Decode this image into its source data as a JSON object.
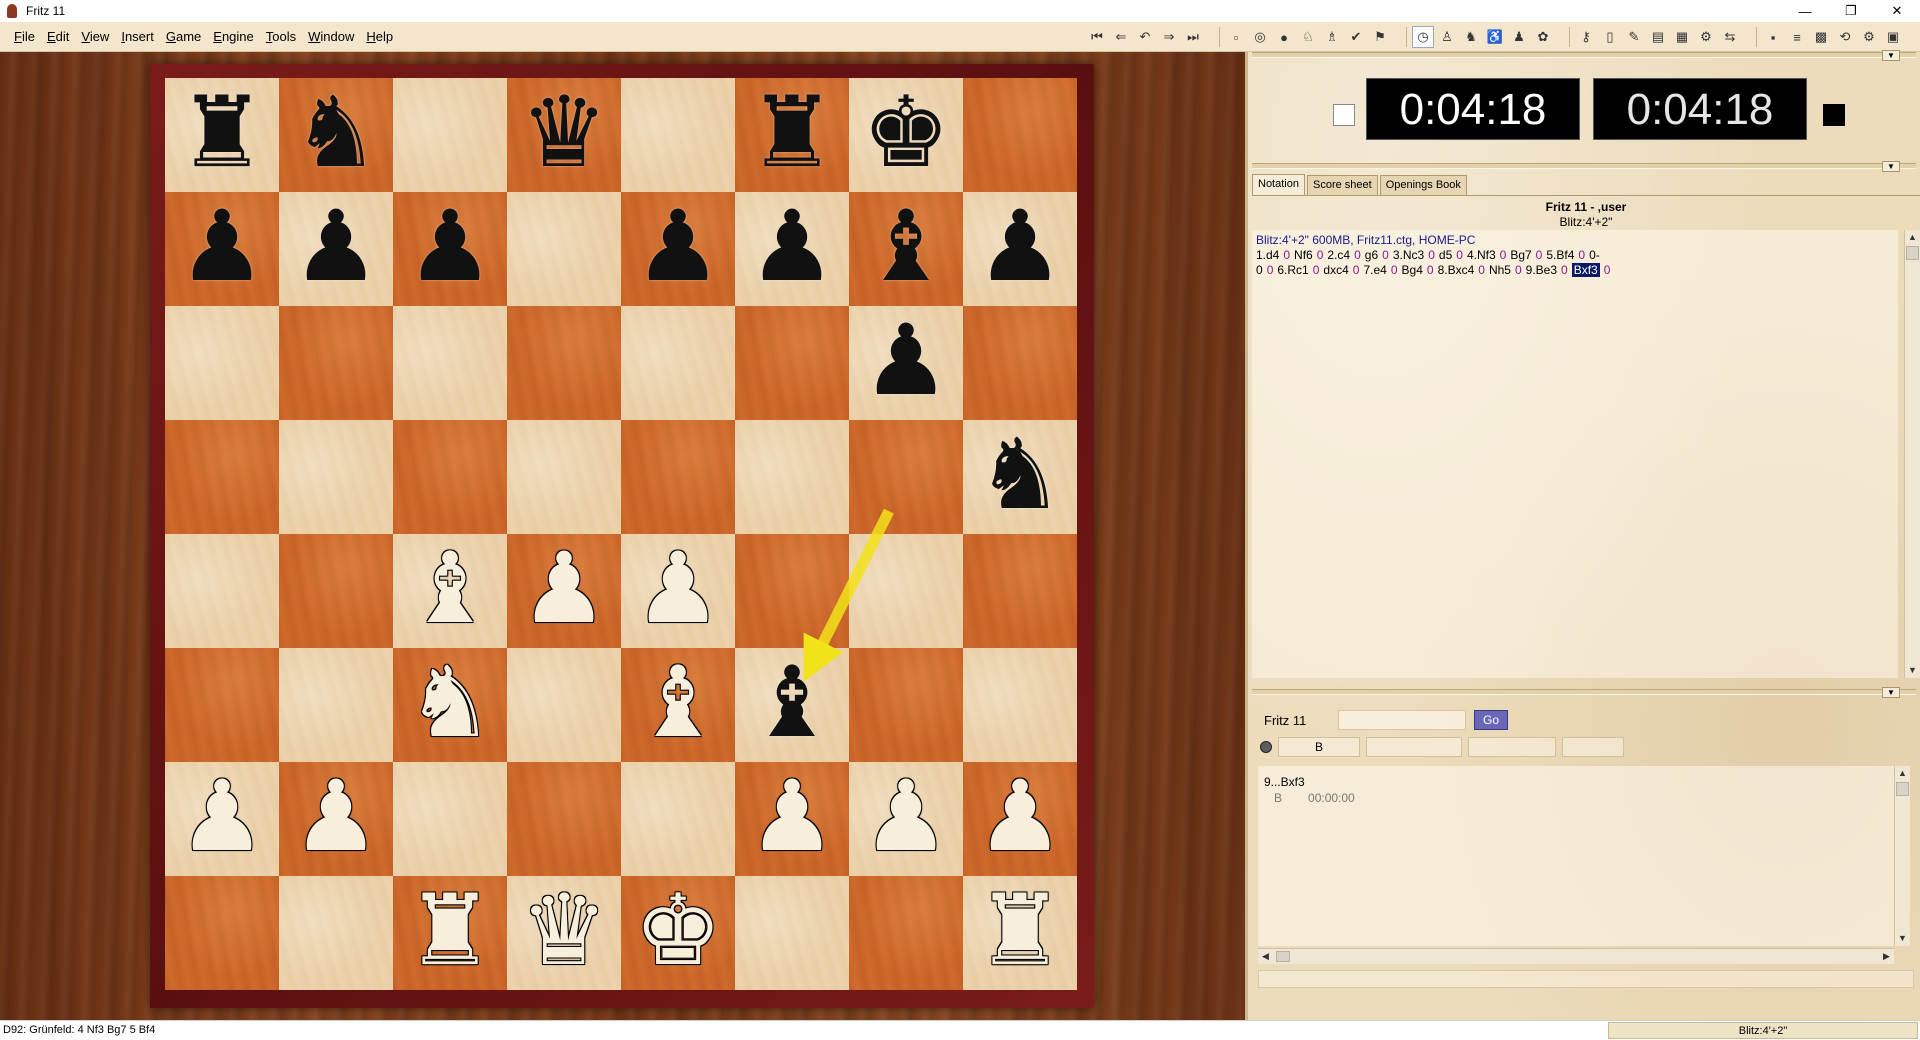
{
  "window": {
    "title": "Fritz 11",
    "controls": {
      "minimize": "—",
      "restore": "❐",
      "close": "✕"
    }
  },
  "menu": [
    {
      "label": "File",
      "mnemonic": "F",
      "rest": "ile"
    },
    {
      "label": "Edit",
      "mnemonic": "E",
      "rest": "dit"
    },
    {
      "label": "View",
      "mnemonic": "V",
      "rest": "iew"
    },
    {
      "label": "Insert",
      "mnemonic": "I",
      "rest": "nsert"
    },
    {
      "label": "Game",
      "mnemonic": "G",
      "rest": "ame"
    },
    {
      "label": "Engine",
      "mnemonic": "E",
      "rest": "ngine"
    },
    {
      "label": "Tools",
      "mnemonic": "T",
      "rest": "ools"
    },
    {
      "label": "Window",
      "mnemonic": "W",
      "rest": "indow"
    },
    {
      "label": "Help",
      "mnemonic": "H",
      "rest": "elp"
    }
  ],
  "toolbar": {
    "nav": [
      {
        "icon": "first-move-icon",
        "glyph": "⏮"
      },
      {
        "icon": "back-move-icon",
        "glyph": "⇐"
      },
      {
        "icon": "take-back-icon",
        "glyph": "↶"
      },
      {
        "icon": "forward-move-icon",
        "glyph": "⇒"
      },
      {
        "icon": "last-move-icon",
        "glyph": "⏭"
      }
    ],
    "game": [
      {
        "icon": "new-game-icon",
        "glyph": "▫"
      },
      {
        "icon": "book-icon",
        "glyph": "◎"
      },
      {
        "icon": "hint-icon",
        "glyph": "●"
      },
      {
        "icon": "analysis-icon",
        "glyph": "♘"
      },
      {
        "icon": "engine-icon",
        "glyph": "♗"
      },
      {
        "icon": "check-icon",
        "glyph": "✔"
      },
      {
        "icon": "flag-icon",
        "glyph": "⚑"
      }
    ],
    "mode": [
      {
        "icon": "clock-icon",
        "glyph": "◷",
        "active": true
      },
      {
        "icon": "pawn-mode-icon",
        "glyph": "♙"
      },
      {
        "icon": "knight-mode-icon",
        "glyph": "♞"
      },
      {
        "icon": "handicap-icon",
        "glyph": "♿"
      },
      {
        "icon": "friend-mode-icon",
        "glyph": "♟"
      },
      {
        "icon": "sparring-icon",
        "glyph": "✿"
      }
    ],
    "tools": [
      {
        "icon": "key-icon",
        "glyph": "⚷"
      },
      {
        "icon": "book-open-icon",
        "glyph": "▯"
      },
      {
        "icon": "pen-icon",
        "glyph": "✎"
      },
      {
        "icon": "database-icon",
        "glyph": "▤"
      },
      {
        "icon": "board-icon",
        "glyph": "▦"
      },
      {
        "icon": "server-icon",
        "glyph": "⚙"
      },
      {
        "icon": "links-icon",
        "glyph": "⇆"
      }
    ],
    "file": [
      {
        "icon": "save-icon",
        "glyph": "▪"
      },
      {
        "icon": "layout-icon",
        "glyph": "≡"
      },
      {
        "icon": "board-3d-icon",
        "glyph": "▩"
      },
      {
        "icon": "flip-board-icon",
        "glyph": "⟲"
      },
      {
        "icon": "settings-icon",
        "glyph": "⚙"
      },
      {
        "icon": "fullscreen-icon",
        "glyph": "▣"
      }
    ]
  },
  "board": {
    "rows": [
      [
        "br",
        "bn",
        "",
        "bq",
        "",
        "br",
        "bk",
        ""
      ],
      [
        "bp",
        "bp",
        "bp",
        "",
        "bp",
        "bp",
        "bb",
        "bp"
      ],
      [
        "",
        "",
        "",
        "",
        "",
        "",
        "bp",
        ""
      ],
      [
        "",
        "",
        "",
        "",
        "",
        "",
        "",
        "bn"
      ],
      [
        "",
        "",
        "wb",
        "wp",
        "wp",
        "",
        "",
        ""
      ],
      [
        "",
        "",
        "wn",
        "",
        "wb",
        "bb",
        "",
        ""
      ],
      [
        "wp",
        "wp",
        "",
        "",
        "",
        "wp",
        "wp",
        "wp"
      ],
      [
        "",
        "",
        "wr",
        "wq",
        "wk",
        "",
        "",
        "wr"
      ]
    ],
    "glyphs": {
      "k": "♚",
      "q": "♛",
      "r": "♜",
      "b": "♝",
      "n": "♞",
      "p": "♟"
    },
    "last_move_arrow": {
      "from": "g5",
      "to": "f3",
      "color": "#f2e21a"
    }
  },
  "clocks": {
    "white_time": "0:04:18",
    "black_time": "0:04:18"
  },
  "notation": {
    "tabs": [
      "Notation",
      "Score sheet",
      "Openings Book"
    ],
    "active_tab": "Notation",
    "players": "Fritz 11 - ,user",
    "event": "Blitz:4'+2\"",
    "game_info": "Blitz:4'+2\"  600MB, Fritz11.ctg, HOME-PC",
    "moves": [
      {
        "san": "1.d4",
        "ann": "0"
      },
      {
        "san": "Nf6",
        "ann": "0"
      },
      {
        "san": "2.c4",
        "ann": "0"
      },
      {
        "san": "g6",
        "ann": "0"
      },
      {
        "san": "3.Nc3",
        "ann": "0"
      },
      {
        "san": "d5",
        "ann": "0"
      },
      {
        "san": "4.Nf3",
        "ann": "0"
      },
      {
        "san": "Bg7",
        "ann": "0"
      },
      {
        "san": "5.Bf4",
        "ann": "0"
      },
      {
        "san": "0-0",
        "ann": "0"
      },
      {
        "san": "6.Rc1",
        "ann": "0"
      },
      {
        "san": "dxc4",
        "ann": "0"
      },
      {
        "san": "7.e4",
        "ann": "0"
      },
      {
        "san": "Bg4",
        "ann": "0"
      },
      {
        "san": "8.Bxc4",
        "ann": "0"
      },
      {
        "san": "Nh5",
        "ann": "0"
      },
      {
        "san": "9.Be3",
        "ann": "0"
      },
      {
        "san": "Bxf3",
        "ann": "0",
        "current": true
      }
    ]
  },
  "engine": {
    "name": "Fritz 11",
    "go_label": "Go",
    "column_b": "B",
    "line": "9...Bxf3",
    "line_b": "B",
    "line_time": "00:00:00"
  },
  "scroll": {
    "up": "▲",
    "down": "▼",
    "left": "◀",
    "right": "▶"
  },
  "splitter_arrow": "▼",
  "status": {
    "left": "D92: Grünfeld: 4 Nf3 Bg7 5 Bf4",
    "right": "Blitz:4'+2\""
  },
  "colors": {
    "light_square": "#ecd3ac",
    "dark_square": "#d06a2c",
    "frame": "#6a1414",
    "current_move_bg": "#0a1a66",
    "go_button": "#6b67b8"
  }
}
